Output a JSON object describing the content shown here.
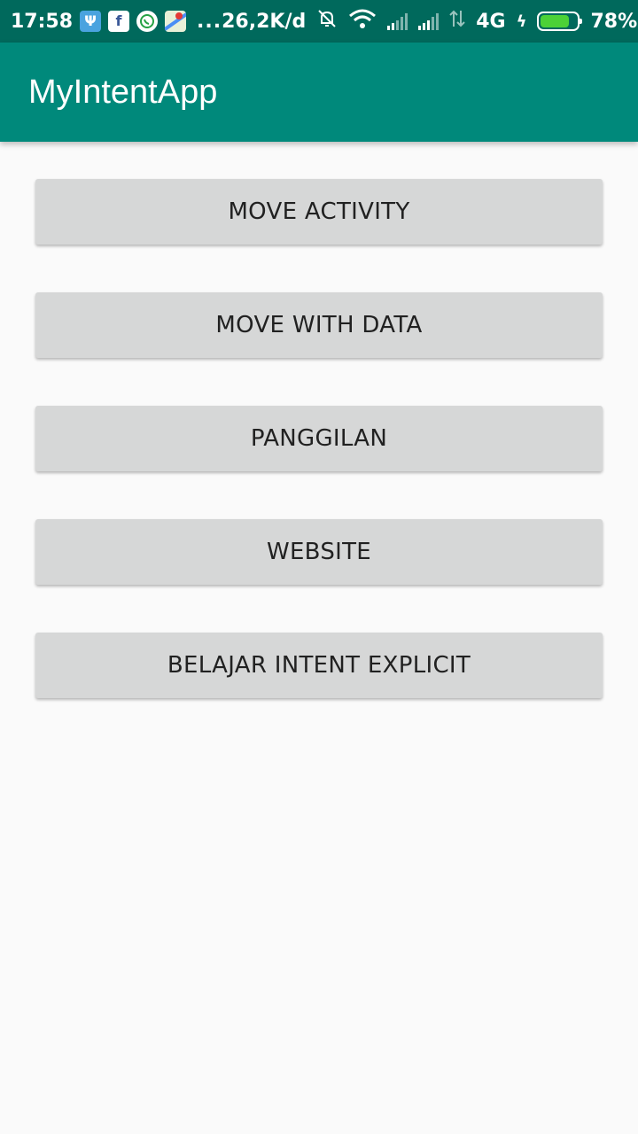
{
  "status_bar": {
    "time": "17:58",
    "notification_icons": [
      "psi-icon",
      "facebook-icon",
      "whatsapp-icon",
      "maps-icon"
    ],
    "overflow": "...",
    "network_speed": "26,2K/d",
    "network_type": "4G",
    "battery_percent": "78%",
    "battery_level": 0.78
  },
  "app_bar": {
    "title": "MyIntentApp"
  },
  "buttons": {
    "move_activity": "MOVE ACTIVITY",
    "move_with_data": "MOVE WITH DATA",
    "panggilan": "PANGGILAN",
    "website": "WEBSITE",
    "belajar_intent_explicit": "BELAJAR INTENT EXPLICIT"
  },
  "colors": {
    "status_bar": "#00695c",
    "app_bar": "#00897b",
    "button_bg": "#d6d7d7",
    "button_text": "#212121",
    "background": "#fafafa"
  }
}
